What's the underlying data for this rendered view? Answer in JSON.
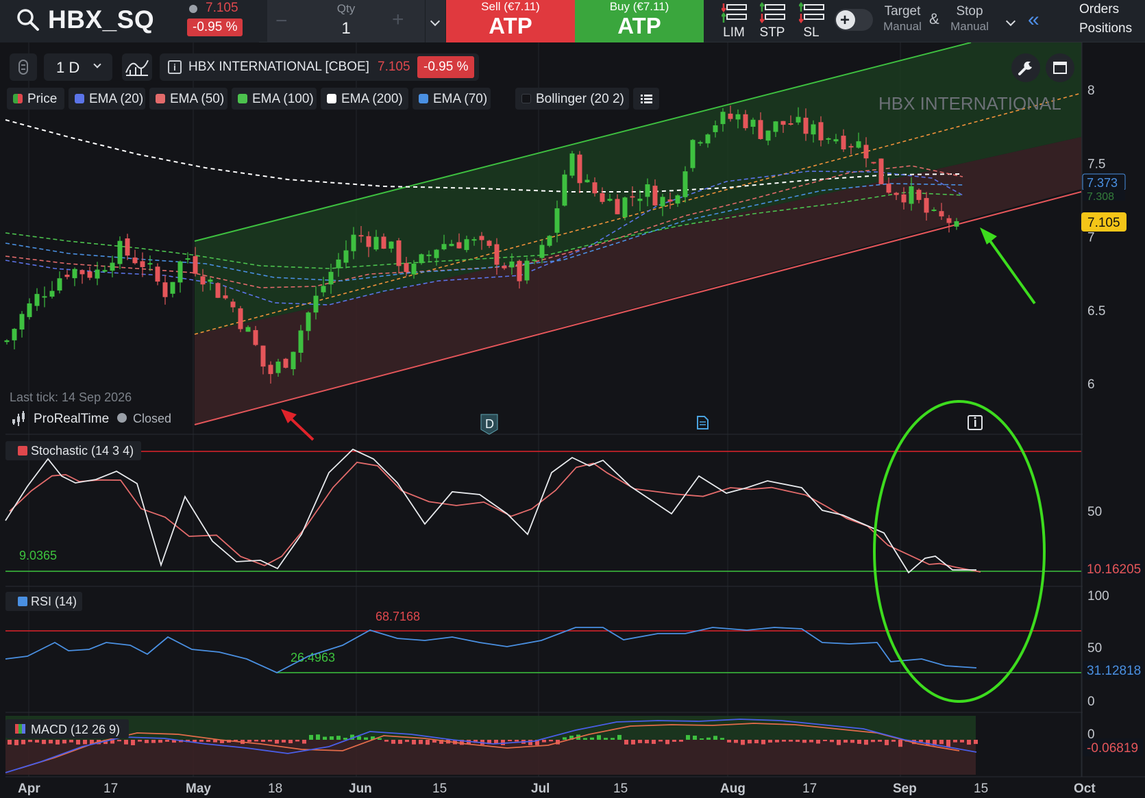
{
  "topbar": {
    "symbol": "HBX_SQ",
    "last_price": "7.105",
    "change_pct": "-0.95 %",
    "qty_label": "Qty",
    "qty_value": "1",
    "qty_minus": "−",
    "qty_plus": "+",
    "sell_label": "Sell (€7.11)",
    "sell_type": "ATP",
    "buy_label": "Buy (€7.11)",
    "buy_type": "ATP",
    "order_types": [
      "LIM",
      "STP",
      "SL"
    ],
    "target_label": "Target",
    "target_mode": "Manual",
    "amp": "&",
    "stop_label": "Stop",
    "stop_mode": "Manual",
    "collapse_glyph": "«",
    "orders_link": "Orders",
    "positions_link": "Positions"
  },
  "chart_toolbar": {
    "timeframe": "1 D",
    "instrument_name": "HBX INTERNATIONAL [CBOE]",
    "instrument_price": "7.105",
    "instrument_change": "-0.95 %",
    "icons": [
      "drag-handle-icon",
      "chart-type-icon",
      "info-icon",
      "wrench-icon",
      "window-icon"
    ]
  },
  "legend": [
    {
      "label": "Price",
      "color": "#3aa63d",
      "color2": "#e0484d"
    },
    {
      "label": "EMA (20)",
      "color": "#5b74e8"
    },
    {
      "label": "EMA (50)",
      "color": "#e36b6b"
    },
    {
      "label": "EMA (100)",
      "color": "#4cc24e"
    },
    {
      "label": "EMA (200)",
      "color": "#ffffff"
    },
    {
      "label": "EMA (70)",
      "color": "#4a90e2"
    },
    {
      "label": "Bollinger (20 2)",
      "color": "#2a2d33"
    }
  ],
  "price_panel": {
    "watermark": "HBX INTERNATIONAL",
    "last_tick": "Last tick: 14 Sep 2026",
    "brand": "ProRealTime",
    "market_status": "Closed",
    "y_ticks": [
      "8",
      "7.5",
      "7",
      "6.5",
      "6"
    ],
    "badges": [
      {
        "text": "7.373",
        "color": "#4a90e2"
      },
      {
        "text": "7.308",
        "color": "#4cc24e"
      },
      {
        "text": "7.105",
        "color": "#f5c518"
      }
    ],
    "event_markers": [
      "D",
      "doc",
      "i"
    ]
  },
  "stochastic": {
    "title": "Stochastic (14 3 4)",
    "low_value": "9.0365",
    "current_badge": "10.16205",
    "y_ticks": [
      "50"
    ]
  },
  "rsi": {
    "title": "RSI (14)",
    "high_value": "68.7168",
    "low_value": "26.4963",
    "current_badge": "31.12818",
    "y_ticks": [
      "100",
      "50",
      "0"
    ]
  },
  "macd": {
    "title": "MACD (12 26 9)",
    "current_badge": "-0.06819",
    "y_ticks": [
      "0"
    ]
  },
  "x_axis": [
    "Apr",
    "17",
    "May",
    "18",
    "Jun",
    "15",
    "Jul",
    "15",
    "Aug",
    "17",
    "Sep",
    "15",
    "Oct"
  ],
  "colors": {
    "up": "#3aa63d",
    "down": "#e0484d",
    "sell": "#e0393e",
    "buy": "#3aa63d",
    "annotation_green": "#3ddc1e",
    "annotation_red": "#e0232a"
  }
}
